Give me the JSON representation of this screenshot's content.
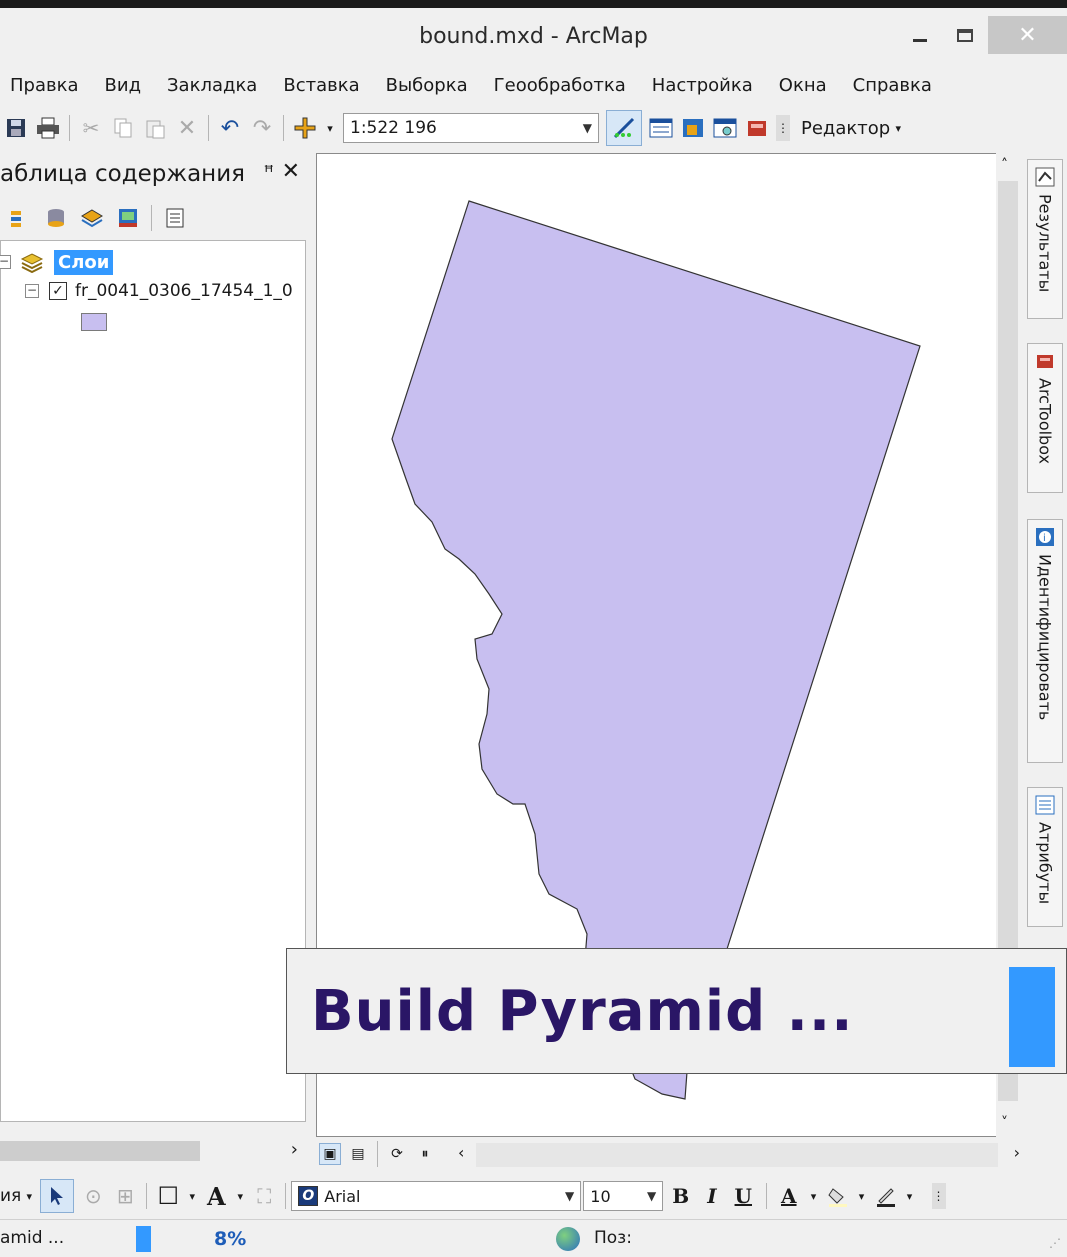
{
  "window": {
    "title": "bound.mxd - ArcMap",
    "close_glyph": "✕"
  },
  "menu": [
    "Правка",
    "Вид",
    "Закладка",
    "Вставка",
    "Выборка",
    "Геообработка",
    "Настройка",
    "Окна",
    "Справка"
  ],
  "toolbar": {
    "scale_value": "1:522 196",
    "editor_label": "Редактор"
  },
  "toc": {
    "title": "аблица содержания",
    "pin_glyph": "ꟸ",
    "close_glyph": "✕",
    "layers_label": "Слои",
    "layer_name": "fr_0041_0306_17454_1_0",
    "layer_checked": "✓",
    "expand_glyph": "−"
  },
  "side_tabs": [
    "Результаты",
    "ArcToolbox",
    "Идентифицировать",
    "Атрибуты"
  ],
  "dialog": {
    "text": "Build Pyramid ..."
  },
  "draw_toolbar": {
    "drawing_label": "ия",
    "font_name": "Arial",
    "font_size": "10",
    "bold": "B",
    "italic": "I",
    "underline": "U",
    "font_color": "A"
  },
  "status": {
    "text": "amid ...",
    "progress_percent": "8%",
    "progress_fraction": 0.08,
    "position_label": "Поз:"
  },
  "colors": {
    "polygon_fill": "#c8bff0",
    "polygon_stroke": "#333333",
    "accent": "#3399ff"
  }
}
